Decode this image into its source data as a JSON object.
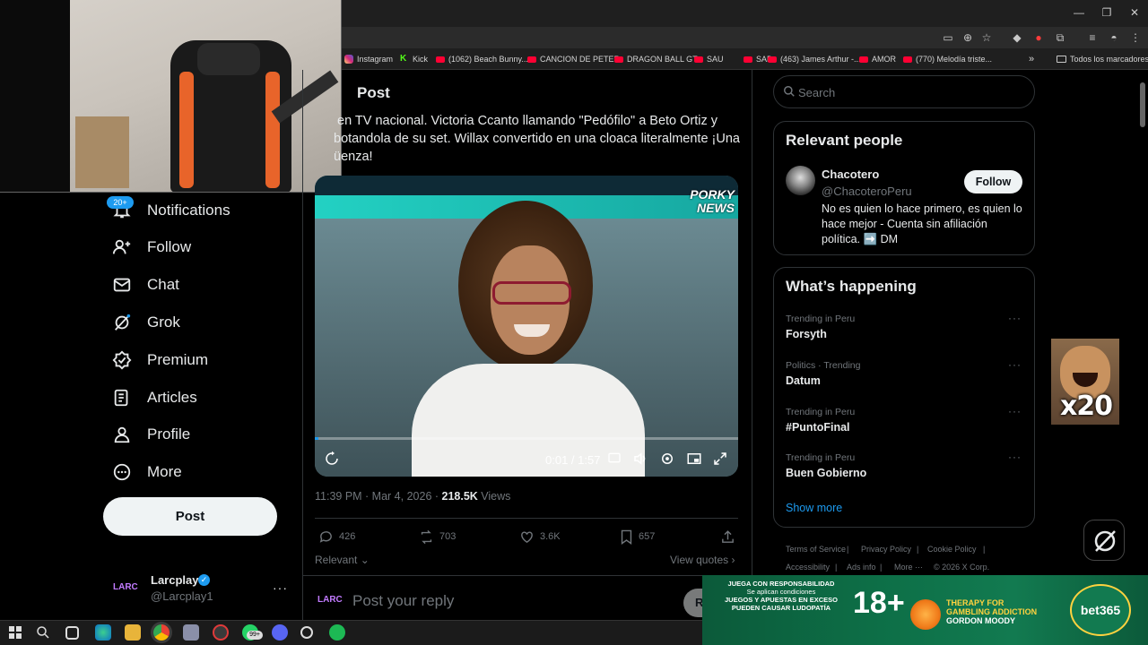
{
  "bookmarks": [
    {
      "label": "Instagram",
      "icon": "instagram-icon"
    },
    {
      "label": "Kick",
      "icon": "kick-icon"
    },
    {
      "label": "(1062) Beach Bunny...",
      "icon": "youtube-icon"
    },
    {
      "label": "CANCION DE PETER",
      "icon": "youtube-icon"
    },
    {
      "label": "DRAGON BALL GT",
      "icon": "youtube-icon"
    },
    {
      "label": "SAU",
      "icon": "youtube-icon"
    },
    {
      "label": "SAD",
      "icon": "youtube-icon"
    },
    {
      "label": "(463) James Arthur -...",
      "icon": "youtube-icon"
    },
    {
      "label": "AMOR",
      "icon": "youtube-icon"
    },
    {
      "label": "(770) Melodía triste...",
      "icon": "youtube-icon"
    }
  ],
  "bookmarks_overflow": "»",
  "bookmarks_all": "Todos los marcadores",
  "nav": {
    "notifications_badge": "20+",
    "items": [
      {
        "label": "Notifications",
        "icon": "bell-icon"
      },
      {
        "label": "Follow",
        "icon": "add-person-icon"
      },
      {
        "label": "Chat",
        "icon": "mail-icon"
      },
      {
        "label": "Grok",
        "icon": "grok-icon"
      },
      {
        "label": "Premium",
        "icon": "verified-icon"
      },
      {
        "label": "Articles",
        "icon": "articles-icon"
      },
      {
        "label": "Profile",
        "icon": "person-icon"
      },
      {
        "label": "More",
        "icon": "more-circle-icon"
      }
    ],
    "post_button": "Post",
    "account": {
      "name": "Larcplay",
      "handle": "@Larcplay1",
      "avatar_text": "LARC"
    }
  },
  "post": {
    "header": "Post",
    "text_lines": [
      "en TV nacional. Victoria Ccanto llamando \"Pedófilo\" a Beto Ortiz y",
      "botandola de su set. Willax convertido en una cloaca literalmente ¡Una",
      "üenza!"
    ],
    "video": {
      "logo_line1": "PORKY",
      "logo_line2": "NEWS",
      "time": "0:01 / 1:57",
      "progress": 0.009
    },
    "meta_time": "11:39 PM · Mar 4, 2026 · ",
    "meta_views_count": "218.5K",
    "meta_views_label": " Views",
    "actions": {
      "replies": "426",
      "reposts": "703",
      "likes": "3.6K",
      "bookmarks": "657"
    },
    "relevant": "Relevant",
    "view_quotes": "View quotes",
    "reply_placeholder": "Post your reply",
    "reply_button": "R"
  },
  "sidebar": {
    "search_placeholder": "Search",
    "relevant_people": {
      "title": "Relevant people",
      "name": "Chacotero",
      "handle": "@ChacoteroPeru",
      "follow": "Follow",
      "bio": "No es quien lo hace primero, es quien lo hace mejor - Cuenta sin afiliación política. ➡️ DM"
    },
    "whats_happening": {
      "title": "What’s happening",
      "trends": [
        {
          "context": "Trending in Peru",
          "name": "Forsyth"
        },
        {
          "context": "Politics · Trending",
          "name": "Datum"
        },
        {
          "context": "Trending in Peru",
          "name": "#PuntoFinal"
        },
        {
          "context": "Trending in Peru",
          "name": "Buen Gobierno"
        }
      ],
      "show_more": "Show more"
    },
    "footer": [
      "Terms of Service",
      "|",
      "Privacy Policy",
      "|",
      "Cookie Policy",
      "|",
      "Accessibility",
      "|",
      "Ads info",
      "|",
      "More ···",
      "© 2026 X Corp."
    ]
  },
  "overlay": {
    "meme_text": "x20"
  },
  "ad": {
    "line1": "JUEGA CON RESPONSABILIDAD",
    "line2": "Se aplican condiciones",
    "line3": "JUEGOS Y APUESTAS EN EXCESO",
    "line4": "PUEDEN CAUSAR LUDOPATÍA",
    "age": "18+",
    "therapy1": "THERAPY FOR",
    "therapy2": "GAMBLING ADDICTION",
    "therapy3": "GORDON MOODY",
    "brand": "bet365"
  },
  "taskbar": {
    "badge": "99+"
  },
  "colors": {
    "accent": "#1d9bf0",
    "background": "#000000",
    "border": "#2f3336",
    "muted": "#71767b"
  }
}
